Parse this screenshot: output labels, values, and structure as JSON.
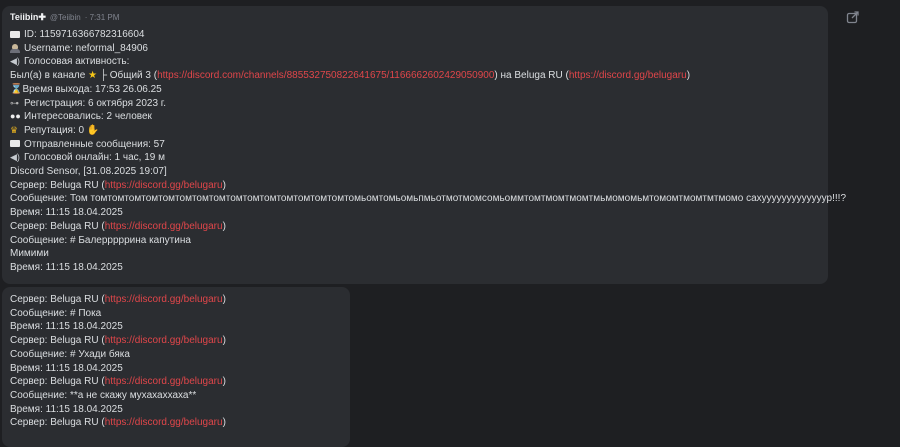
{
  "message1": {
    "author": "Teiibin",
    "author_badge": "✚",
    "handle": "@Teiibin",
    "time": "· 7:31 PM",
    "id_line": "ID: 1159716366782316604",
    "username_line": "Username: neformal_84906",
    "voice_activity": "Голосовая активность:",
    "channel_prefix": "Был(а) в канале",
    "channel_name": "├ Общий 3 (",
    "channel_link": "https://discord.com/channels/885532750822641675/1166662602429050900",
    "channel_mid": ") на Beluga RU (",
    "server_link": "https://discord.gg/belugaru",
    "paren_close": ")",
    "exit_time": "Время выхода: 17:53 26.06.25",
    "registration": "Регистрация: 6 октября 2023 г.",
    "interested": "Интересовались: 2 человек",
    "reputation": "Репутация: 0",
    "sent_messages": "Отправленные сообщения: 57",
    "voice_online": "Голосовой онлайн: 1 час, 19 м",
    "sensor": "Discord Sensor, [31.08.2025 19:07]",
    "server_prefix": "Сервер: Beluga RU (",
    "msg_long": "Сообщение: Том томтомтомтомтомтомтомтомтомтомтомтомтомтомтомтомьомтомьомьпмьотмотмомсомьоммтомтмомтмомтмьмомомьмтомомтмомтмтмомо сахууууууууууууур!!!?",
    "time_line": "Время: 11:15 18.04.2025",
    "msg_ballerina": "Сообщение: # Балерррррина капутина",
    "mimimi": "Мимими"
  },
  "message2": {
    "server_prefix": "Сервер: Beluga RU (",
    "server_link": "https://discord.gg/belugaru",
    "paren_close": ")",
    "msg_poka": "Сообщение: # Пока",
    "msg_uhodi": "Сообщение: # Ухади бяка",
    "msg_skazhu": "Сообщение: **а не скажу мухахаххаха**",
    "time_line": "Время: 11:15 18.04.2025"
  },
  "icons": {
    "mail": "envelope-icon",
    "user": "bust-icon",
    "speaker": "speaker-icon",
    "star": "star-icon",
    "hourglass": "hourglass-icon",
    "key": "key-icon",
    "eyes": "eyes-icon",
    "trophy": "trophy-icon",
    "thumb": "thumbs-up-icon",
    "edit": "new-window-icon"
  },
  "colors": {
    "background": "#1e1f22",
    "bubble": "#2b2d31",
    "link": "#e0464a",
    "text": "#dbdee1"
  }
}
